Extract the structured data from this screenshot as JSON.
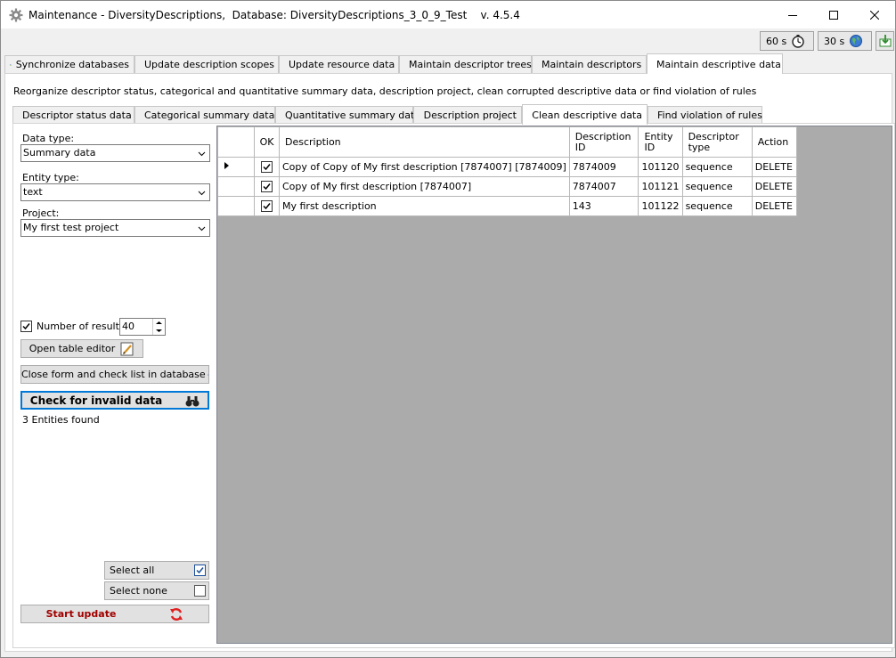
{
  "window": {
    "title": "Maintenance - DiversityDescriptions,  Database: DiversityDescriptions_3_0_9_Test    v. 4.5.4"
  },
  "toolbar": {
    "timer1": "60 s",
    "timer2": "30 s"
  },
  "main_tabs": [
    "Synchronize databases",
    "Update description scopes",
    "Update resource data",
    "Maintain descriptor trees",
    "Maintain descriptors",
    "Maintain descriptive data"
  ],
  "description": "Reorganize descriptor status, categorical and quantitative summary data, description project, clean corrupted descriptive data or find violation of rules",
  "sub_tabs": [
    "Descriptor status data",
    "Categorical summary data",
    "Quantitative summary data",
    "Description project",
    "Clean descriptive data",
    "Find violation of rules"
  ],
  "filters": {
    "data_type_label": "Data type:",
    "data_type_value": "Summary data",
    "entity_type_label": "Entity type:",
    "entity_type_value": "text",
    "project_label": "Project:",
    "project_value": "My first test project"
  },
  "results": {
    "number_label": "Number of results:",
    "number_value": "40",
    "number_checked": true
  },
  "buttons": {
    "open_table_editor": "Open table editor",
    "close_form": "Close form and check list in database",
    "check_invalid": "Check for invalid data",
    "select_all": "Select all",
    "select_none": "Select none",
    "start_update": "Start update"
  },
  "status": "3 Entities found",
  "table": {
    "headers": [
      "OK",
      "Description",
      "Description ID",
      "Entity ID",
      "Descriptor type",
      "Action"
    ],
    "rows": [
      {
        "ok": true,
        "description": "Copy of Copy of My first description [7874007] [7874009]",
        "description_id": "7874009",
        "entity_id": "101120",
        "descriptor_type": "sequence",
        "action": "DELETE"
      },
      {
        "ok": true,
        "description": "Copy of My first description [7874007]",
        "description_id": "7874007",
        "entity_id": "101121",
        "descriptor_type": "sequence",
        "action": "DELETE"
      },
      {
        "ok": true,
        "description": "My first description",
        "description_id": "143",
        "entity_id": "101122",
        "descriptor_type": "sequence",
        "action": "DELETE"
      }
    ]
  },
  "colors": {
    "start_update_text": "#a00000",
    "focus_border": "#0078d7"
  }
}
